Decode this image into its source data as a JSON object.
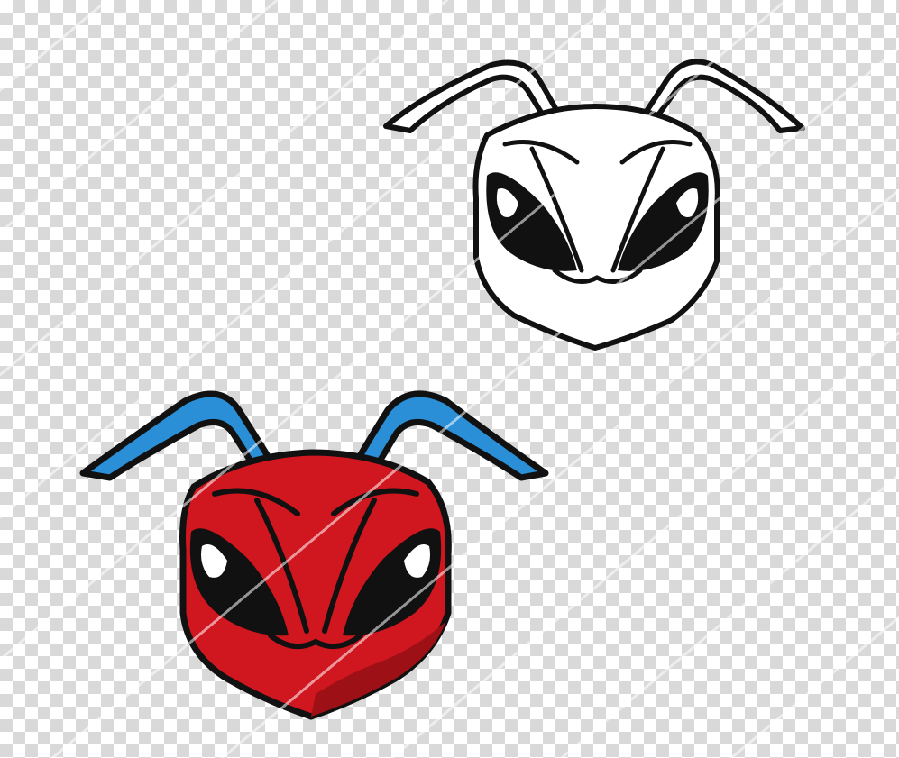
{
  "canvas": {
    "background": "transparent-checkerboard",
    "checker_color": "#d9d9d9"
  },
  "artwork": [
    {
      "name": "ant-head-outline",
      "style": "black-and-white line art",
      "stroke_color": "#111111",
      "fill_color": "#ffffff"
    },
    {
      "name": "ant-head-color",
      "style": "full color mascot",
      "head_color": "#d0161e",
      "head_shadow_color": "#9c1016",
      "antenna_color": "#2a8fd6",
      "eye_white": "#ffffff",
      "eye_black": "#111111",
      "outline_color": "#111111"
    }
  ]
}
